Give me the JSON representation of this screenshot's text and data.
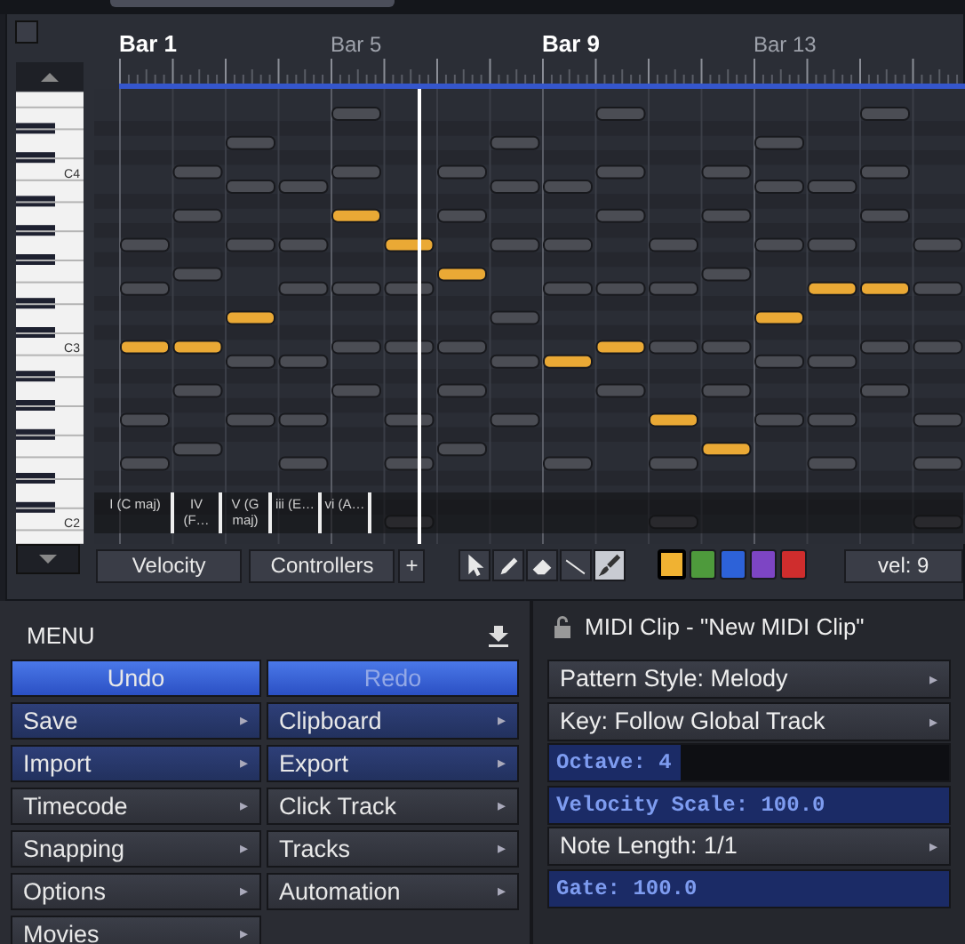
{
  "piano_roll": {
    "note_rows": [
      {
        "notes": [
          {
            "selected": false
          },
          {
            "selected": false
          },
          {
            "selected": false
          }
        ]
      },
      {
        "notes": [
          {
            "selected": false
          },
          {
            "selected": false
          },
          {
            "selected": false
          }
        ]
      },
      {
        "notes": [
          {
            "selected": false
          },
          {
            "selected": false
          },
          {
            "selected": false
          },
          {
            "selected": false
          },
          {
            "selected": false
          },
          {
            "selected": false
          }
        ]
      },
      {
        "notes": [
          {
            "selected": false
          },
          {
            "selected": false
          },
          {
            "selected": false
          },
          {
            "selected": false
          },
          {
            "selected": false
          },
          {
            "selected": false
          }
        ]
      },
      {
        "notes": [
          {
            "selected": false
          },
          {
            "selected": true
          },
          {
            "selected": false
          },
          {
            "selected": false
          },
          {
            "selected": false
          },
          {
            "selected": false
          }
        ]
      },
      {
        "notes": [
          {
            "selected": false
          },
          {
            "selected": false
          },
          {
            "selected": false
          },
          {
            "selected": true
          },
          {
            "selected": false
          },
          {
            "selected": false
          },
          {
            "selected": false
          },
          {
            "selected": false
          },
          {
            "selected": false
          },
          {
            "selected": false
          }
        ]
      },
      {
        "notes": [
          {
            "selected": false
          },
          {
            "selected": true
          },
          {
            "selected": false
          }
        ]
      },
      {
        "notes": [
          {
            "selected": false
          },
          {
            "selected": false
          },
          {
            "selected": false
          },
          {
            "selected": false
          },
          {
            "selected": false
          },
          {
            "selected": false
          },
          {
            "selected": false
          },
          {
            "selected": true
          },
          {
            "selected": true
          },
          {
            "selected": false
          }
        ]
      },
      {
        "notes": [
          {
            "selected": true
          },
          {
            "selected": false
          },
          {
            "selected": true
          }
        ]
      },
      {
        "notes": [
          {
            "selected": true
          },
          {
            "selected": true
          },
          {
            "selected": false
          },
          {
            "selected": false
          },
          {
            "selected": false
          },
          {
            "selected": true
          },
          {
            "selected": false
          },
          {
            "selected": false
          },
          {
            "selected": false
          },
          {
            "selected": false
          }
        ]
      },
      {
        "notes": [
          {
            "selected": false
          },
          {
            "selected": false
          },
          {
            "selected": false
          },
          {
            "selected": true
          },
          {
            "selected": false
          },
          {
            "selected": false
          }
        ]
      },
      {
        "notes": [
          {
            "selected": false
          },
          {
            "selected": false
          },
          {
            "selected": false
          },
          {
            "selected": false
          },
          {
            "selected": false
          },
          {
            "selected": false
          }
        ]
      },
      {
        "notes": [
          {
            "selected": false
          },
          {
            "selected": false
          },
          {
            "selected": false
          },
          {
            "selected": false
          },
          {
            "selected": false
          },
          {
            "selected": true
          },
          {
            "selected": false
          },
          {
            "selected": false
          },
          {
            "selected": false
          }
        ]
      },
      {
        "notes": [
          {
            "selected": false
          },
          {
            "selected": false
          },
          {
            "selected": true
          }
        ]
      },
      {
        "notes": [
          {
            "selected": false
          },
          {
            "selected": false
          },
          {
            "selected": false
          },
          {
            "selected": false
          },
          {
            "selected": false
          },
          {
            "selected": false
          },
          {
            "selected": false
          }
        ]
      },
      {
        "notes": [
          {
            "selected": false
          },
          {
            "selected": false
          },
          {
            "selected": false
          }
        ]
      }
    ],
    "ruler": [
      {
        "label": "Bar 1",
        "highlighted": true
      },
      {
        "label": "Bar 5",
        "highlighted": false
      },
      {
        "label": "Bar 9",
        "highlighted": true
      },
      {
        "label": "Bar 13",
        "highlighted": false
      }
    ],
    "key_labels": [
      "C4",
      "C3",
      "C2"
    ]
  },
  "chords": [
    "I (C maj)",
    "IV (F…",
    "V (G maj)",
    "iii (E…",
    "vi (A…"
  ],
  "toolbar": {
    "lanes": [
      "Velocity",
      "Controllers"
    ],
    "add": "+",
    "tools": [
      {
        "selected": false
      },
      {
        "selected": false
      },
      {
        "selected": false
      },
      {
        "selected": false
      },
      {
        "selected": true
      }
    ],
    "colors": [
      {
        "color": "#f0b232",
        "selected": true
      },
      {
        "color": "#4e9a3c",
        "selected": false
      },
      {
        "color": "#2d62d8",
        "selected": false
      },
      {
        "color": "#7d45c4",
        "selected": false
      },
      {
        "color": "#cf2d2d",
        "selected": false
      }
    ],
    "velocity": "vel: 9"
  },
  "menu": {
    "title": "MENU",
    "items": [
      {
        "label": "Undo",
        "kind": "action",
        "highlighted": false,
        "disabled": false
      },
      {
        "label": "Redo",
        "kind": "action",
        "highlighted": false,
        "disabled": true
      },
      {
        "label": "Save",
        "kind": "submenu",
        "arrow": "▸",
        "highlighted": true,
        "disabled": false
      },
      {
        "label": "Clipboard",
        "kind": "submenu",
        "arrow": "▸",
        "highlighted": true,
        "disabled": false
      },
      {
        "label": "Import",
        "kind": "submenu",
        "arrow": "▸",
        "highlighted": true,
        "disabled": false
      },
      {
        "label": "Export",
        "kind": "submenu",
        "arrow": "▸",
        "highlighted": true,
        "disabled": false
      },
      {
        "label": "Timecode",
        "kind": "submenu",
        "arrow": "▸",
        "highlighted": false,
        "disabled": false
      },
      {
        "label": "Click Track",
        "kind": "submenu",
        "arrow": "▸",
        "highlighted": false,
        "disabled": false
      },
      {
        "label": "Snapping",
        "kind": "submenu",
        "arrow": "▸",
        "highlighted": false,
        "disabled": false
      },
      {
        "label": "Tracks",
        "kind": "submenu",
        "arrow": "▸",
        "highlighted": false,
        "disabled": false
      },
      {
        "label": "Options",
        "kind": "submenu",
        "arrow": "▸",
        "highlighted": false,
        "disabled": false
      },
      {
        "label": "Automation",
        "kind": "submenu",
        "arrow": "▸",
        "highlighted": false,
        "disabled": false
      },
      {
        "label": "Movies",
        "kind": "submenu",
        "arrow": "▸",
        "highlighted": false,
        "disabled": false
      }
    ]
  },
  "clip": {
    "title": "MIDI Clip - \"New MIDI Clip\"",
    "rows": [
      {
        "kind": "menu",
        "label": "Pattern Style: Melody",
        "arrow": "▸"
      },
      {
        "kind": "menu",
        "label": "Key: Follow Global Track",
        "arrow": "▸"
      },
      {
        "kind": "slider",
        "label": "Octave: 4",
        "level": 0.33
      },
      {
        "kind": "slider",
        "label": "Velocity Scale: 100.0",
        "level": 1.0
      },
      {
        "kind": "menu",
        "label": "Note Length: 1/1",
        "arrow": "▸"
      },
      {
        "kind": "slider",
        "label": "Gate: 100.0",
        "level": 1.0
      }
    ]
  }
}
